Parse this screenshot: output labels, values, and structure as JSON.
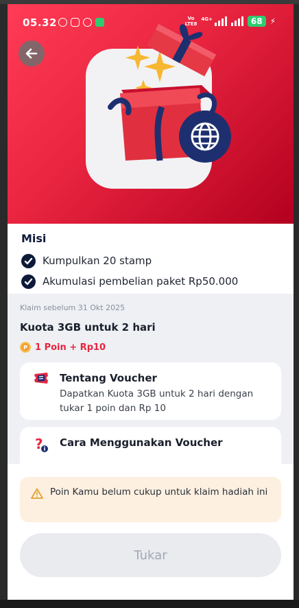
{
  "status_bar": {
    "time": "05.32",
    "network": "Vo\nLTE8",
    "signal_label": "4G+",
    "battery": "68"
  },
  "mission": {
    "title": "Misi",
    "items": [
      {
        "label": "Kumpulkan 20 stamp",
        "done": true
      },
      {
        "label": "Akumulasi pembelian paket Rp50.000",
        "done": true
      }
    ]
  },
  "reward": {
    "deadline": "Klaim sebelum 31 Okt 2025",
    "title": "Kuota 3GB untuk 2 hari",
    "price": "1 Poin + Rp10"
  },
  "about_voucher": {
    "title": "Tentang Voucher",
    "description": "Dapatkan Kuota 3GB untuk 2 hari dengan tukar 1 poin dan Rp 10"
  },
  "how_to_use": {
    "title": "Cara Menggunakan Voucher"
  },
  "warning": {
    "text": "Poin Kamu belum cukup untuk klaim hadiah ini"
  },
  "redeem_button": {
    "label": "Tukar",
    "enabled": false
  },
  "colors": {
    "accent_red": "#e8243f",
    "navy": "#0e1a3a",
    "warning_bg": "#fdf0e0"
  }
}
